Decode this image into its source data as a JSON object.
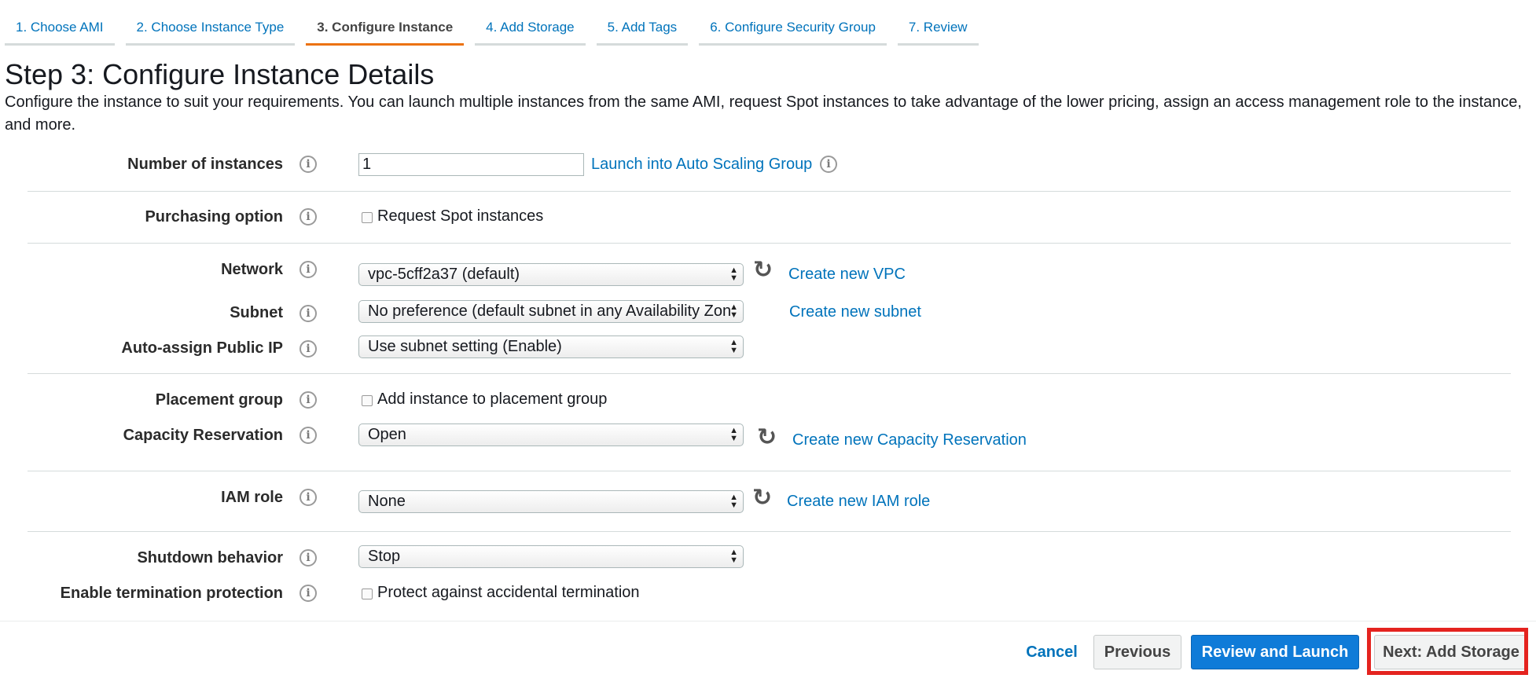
{
  "tabs": [
    {
      "label": "1. Choose AMI",
      "active": false
    },
    {
      "label": "2. Choose Instance Type",
      "active": false
    },
    {
      "label": "3. Configure Instance",
      "active": true
    },
    {
      "label": "4. Add Storage",
      "active": false
    },
    {
      "label": "5. Add Tags",
      "active": false
    },
    {
      "label": "6. Configure Security Group",
      "active": false
    },
    {
      "label": "7. Review",
      "active": false
    }
  ],
  "page": {
    "title": "Step 3: Configure Instance Details",
    "description": "Configure the instance to suit your requirements. You can launch multiple instances from the same AMI, request Spot instances to take advantage of the lower pricing, assign an access management role to the instance, and more."
  },
  "form": {
    "number_of_instances": {
      "label": "Number of instances",
      "value": "1",
      "link": "Launch into Auto Scaling Group"
    },
    "purchasing_option": {
      "label": "Purchasing option",
      "checkbox_label": "Request Spot instances",
      "checked": false
    },
    "network": {
      "label": "Network",
      "value": "vpc-5cff2a37 (default)",
      "link": "Create new VPC"
    },
    "subnet": {
      "label": "Subnet",
      "value": "No preference (default subnet in any Availability Zon",
      "link": "Create new subnet"
    },
    "auto_assign_ip": {
      "label": "Auto-assign Public IP",
      "value": "Use subnet setting (Enable)"
    },
    "placement_group": {
      "label": "Placement group",
      "checkbox_label": "Add instance to placement group",
      "checked": false
    },
    "capacity_reservation": {
      "label": "Capacity Reservation",
      "value": "Open",
      "link": "Create new Capacity Reservation"
    },
    "iam_role": {
      "label": "IAM role",
      "value": "None",
      "link": "Create new IAM role"
    },
    "shutdown_behavior": {
      "label": "Shutdown behavior",
      "value": "Stop"
    },
    "termination_protection": {
      "label": "Enable termination protection",
      "checkbox_label": "Protect against accidental termination",
      "checked": false
    }
  },
  "footer": {
    "cancel": "Cancel",
    "previous": "Previous",
    "review_launch": "Review and Launch",
    "next": "Next: Add Storage"
  },
  "colors": {
    "link": "#0073bb",
    "active_tab_underline": "#ec7211",
    "primary_button": "#0f7bd8",
    "highlight_box": "#e4231f"
  }
}
